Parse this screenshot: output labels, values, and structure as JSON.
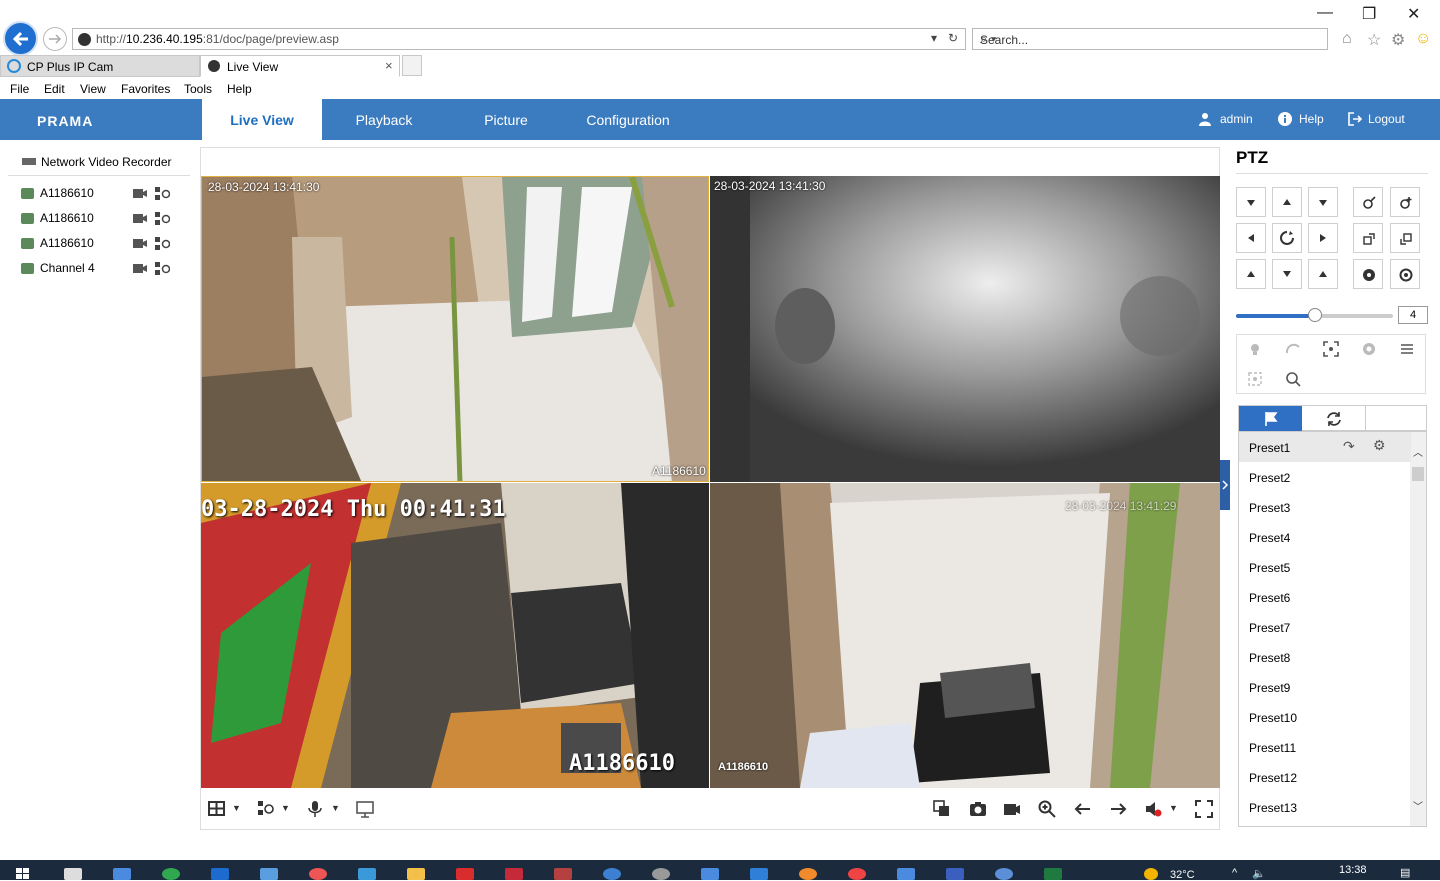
{
  "browser": {
    "url_prefix": "http://",
    "url_host": "10.236.40.195",
    "url_rest": ":81/doc/page/preview.asp",
    "search_placeholder": "Search...",
    "tabs": [
      {
        "label": "CP Plus IP Cam",
        "active": false
      },
      {
        "label": "Live View",
        "active": true
      }
    ],
    "tab_close": "×",
    "menu": [
      "File",
      "Edit",
      "View",
      "Favorites",
      "Tools",
      "Help"
    ],
    "window_controls": {
      "minimize": "—",
      "restore": "❐",
      "close": "✕"
    }
  },
  "app": {
    "logo": "PRAMA",
    "nav": [
      {
        "label": "Live View",
        "active": true
      },
      {
        "label": "Playback",
        "active": false
      },
      {
        "label": "Picture",
        "active": false
      },
      {
        "label": "Configuration",
        "active": false
      }
    ],
    "user": "admin",
    "help": "Help",
    "logout": "Logout",
    "accent": "#3b7bbf"
  },
  "tree": {
    "root": "Network Video Recorder",
    "channels": [
      "A1186610",
      "A1186610",
      "A1186610",
      "Channel 4"
    ]
  },
  "video": {
    "cells": [
      {
        "osd_time": "28-03-2024 13:41:30",
        "osd_name": "A1186610",
        "selected": true
      },
      {
        "osd_time": "28-03-2024 13:41:30",
        "osd_name": "",
        "selected": false
      },
      {
        "osd_time": "03-28-2024 Thu 00:41:31",
        "osd_name": "A1186610",
        "selected": false
      },
      {
        "osd_time": "28-03-2024 13:41:29",
        "osd_name": "A1186610",
        "selected": false
      }
    ]
  },
  "ptz": {
    "title": "PTZ",
    "speed": "4",
    "speed_fraction": 0.5,
    "presets": [
      "Preset1",
      "Preset2",
      "Preset3",
      "Preset4",
      "Preset5",
      "Preset6",
      "Preset7",
      "Preset8",
      "Preset9",
      "Preset10",
      "Preset11",
      "Preset12",
      "Preset13"
    ]
  },
  "taskbar": {
    "temp": "32°C",
    "time": "13:38"
  }
}
